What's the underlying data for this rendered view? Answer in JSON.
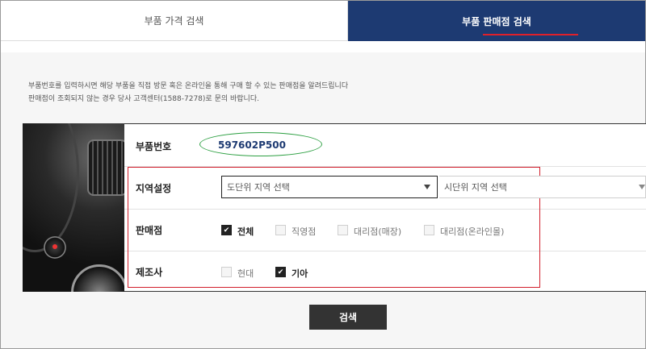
{
  "tabs": {
    "price_search": "부품 가격 검색",
    "dealer_search": "부품 판매점 검색"
  },
  "description": {
    "line1": "부품번호를 입력하시면 해당 부품을 직접 방문 혹은 온라인을 통해 구매 할 수 있는 판매점을 알려드립니다",
    "line2": "판매점이 조회되지 않는 경우 당사 고객센터(1588-7278)로 문의 바랍니다."
  },
  "form": {
    "part_number_label": "부품번호",
    "part_number_value": "597602P500",
    "region_label": "지역설정",
    "province_placeholder": "도단위 지역 선택",
    "city_placeholder": "시단위 지역 선택",
    "store_label": "판매점",
    "store_options": [
      {
        "label": "전체",
        "checked": true
      },
      {
        "label": "직영점",
        "checked": false
      },
      {
        "label": "대리점(매장)",
        "checked": false
      },
      {
        "label": "대리점(온라인몰)",
        "checked": false
      }
    ],
    "maker_label": "제조사",
    "maker_options": [
      {
        "label": "현대",
        "checked": false
      },
      {
        "label": "기아",
        "checked": true
      }
    ]
  },
  "search_button": "검색",
  "colors": {
    "active_tab": "#1d3a72",
    "highlight_green": "#2ea043",
    "highlight_red": "#d21e2b"
  }
}
